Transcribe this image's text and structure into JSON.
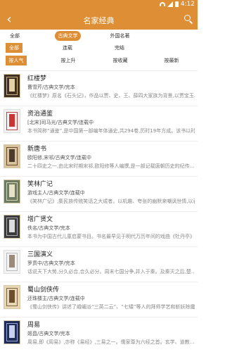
{
  "statusbar": {
    "left": "",
    "time": "4:12"
  },
  "appbar": {
    "title": "名家经典"
  },
  "filters": {
    "row1": [
      "全部",
      "古典文学",
      "外国名著"
    ],
    "row2": [
      "全部",
      "连载",
      "完结"
    ],
    "row3": [
      "按人气",
      "按上升",
      "按收藏",
      "按最新"
    ]
  },
  "books": [
    {
      "title": "红楼梦",
      "meta": "曹雪芹/古典文学/完本",
      "desc": "《红楼梦》原名《石头记》，作品以贾、史、王、薛四大家族为背景,以贾宝玉..."
    },
    {
      "title": "资治通鉴",
      "meta": "[北宋]司马光/古典文学/连载中",
      "desc": "本书简称“通鉴”,是中国第一部编年体通史,共294卷,历时19年方成。该书以时间..."
    },
    {
      "title": "新唐书",
      "meta": "欧阳修,宋祁/古典文学/连载中",
      "desc": "二十四史之一,由北宋时期宋祁,欧阳修等人编撰,是一部记载唐朝历史的纪传..."
    },
    {
      "title": "笑林广记",
      "meta": "游戏主人/古典文学/连载中",
      "desc": "《笑林广记》,集民族传统笑话之大成者。以机趣、夸张的幽默来嘲讽世情,以表..."
    },
    {
      "title": "增广贤文",
      "meta": "佚名/古典文学/完本",
      "desc": "本书为中国古代儿童启蒙书目。书名最早见于明代万历年间的戏曲《牡丹亭》..."
    },
    {
      "title": "三国演义",
      "meta": "罗贯中/古典文学/完本",
      "desc": "话说天下大势,分久必合,合久必分。周末七国分争,并入于秦。及秦灭之后,楚..."
    },
    {
      "title": "蜀山剑侠传",
      "meta": "还珠楼主/古典文学/连载中",
      "desc": "《蜀山剑侠传》讲述了峨嵋派“三英二云”、“七矮”等人的拜师学艺和斩妖除魔..."
    },
    {
      "title": "周易",
      "meta": "姬昌/古典文学/完本",
      "desc": "周易,即《周易》,亦称《易经》,三易之一。儒家尊为六经之首。玄学、道教..."
    }
  ]
}
